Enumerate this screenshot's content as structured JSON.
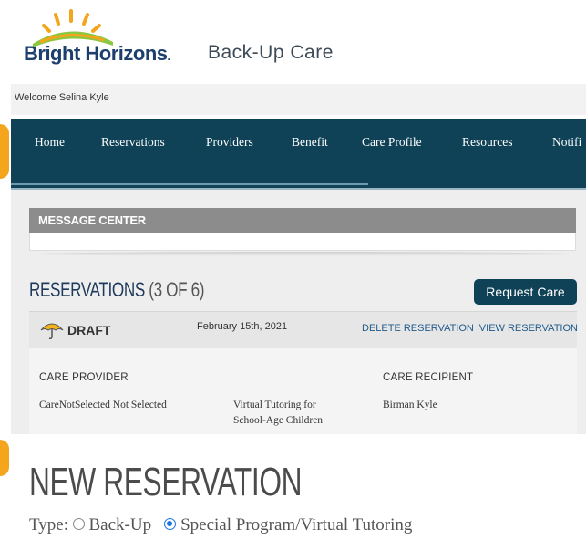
{
  "header": {
    "brand": "Bright Horizons",
    "brand_mark": ".",
    "product": "Back-Up Care"
  },
  "welcome": "Welcome Selina Kyle",
  "nav": {
    "items": [
      {
        "label": "Home"
      },
      {
        "label": "Reservations"
      },
      {
        "label": "Providers"
      },
      {
        "label": "Benefit"
      },
      {
        "label": "Care Profile"
      },
      {
        "label": "Resources"
      },
      {
        "label": "Notifi"
      }
    ]
  },
  "message_center": {
    "title": "MESSAGE CENTER"
  },
  "reservations": {
    "title": "RESERVATIONS",
    "count": "(3 OF 6)",
    "request_button": "Request Care",
    "draft": {
      "status": "DRAFT",
      "date": "February 15th, 2021",
      "delete_link": "DELETE RESERVATION",
      "separator": "|",
      "view_link": "VIEW RESERVATION"
    },
    "columns": {
      "provider": "CARE PROVIDER",
      "recipient": "CARE RECIPIENT"
    },
    "row": {
      "provider_name": "CareNotSelected Not Selected",
      "program_line1": "Virtual Tutoring for",
      "program_line2": "School-Age Children",
      "recipient_name": "Birman Kyle"
    }
  },
  "new_reservation": {
    "title": "NEW RESERVATION",
    "type_label": "Type:",
    "options": [
      {
        "label": "Back-Up",
        "selected": false
      },
      {
        "label": "Special Program/Virtual Tutoring",
        "selected": true
      }
    ]
  },
  "colors": {
    "nav_bg": "#0f4256",
    "brand_navy": "#1c3f6e",
    "accent_orange": "#f4a51c",
    "link_blue": "#1f5a8a",
    "radio_blue": "#1a73e8"
  },
  "icons": {
    "logo": "sun-rising-icon",
    "draft": "umbrella-icon"
  }
}
